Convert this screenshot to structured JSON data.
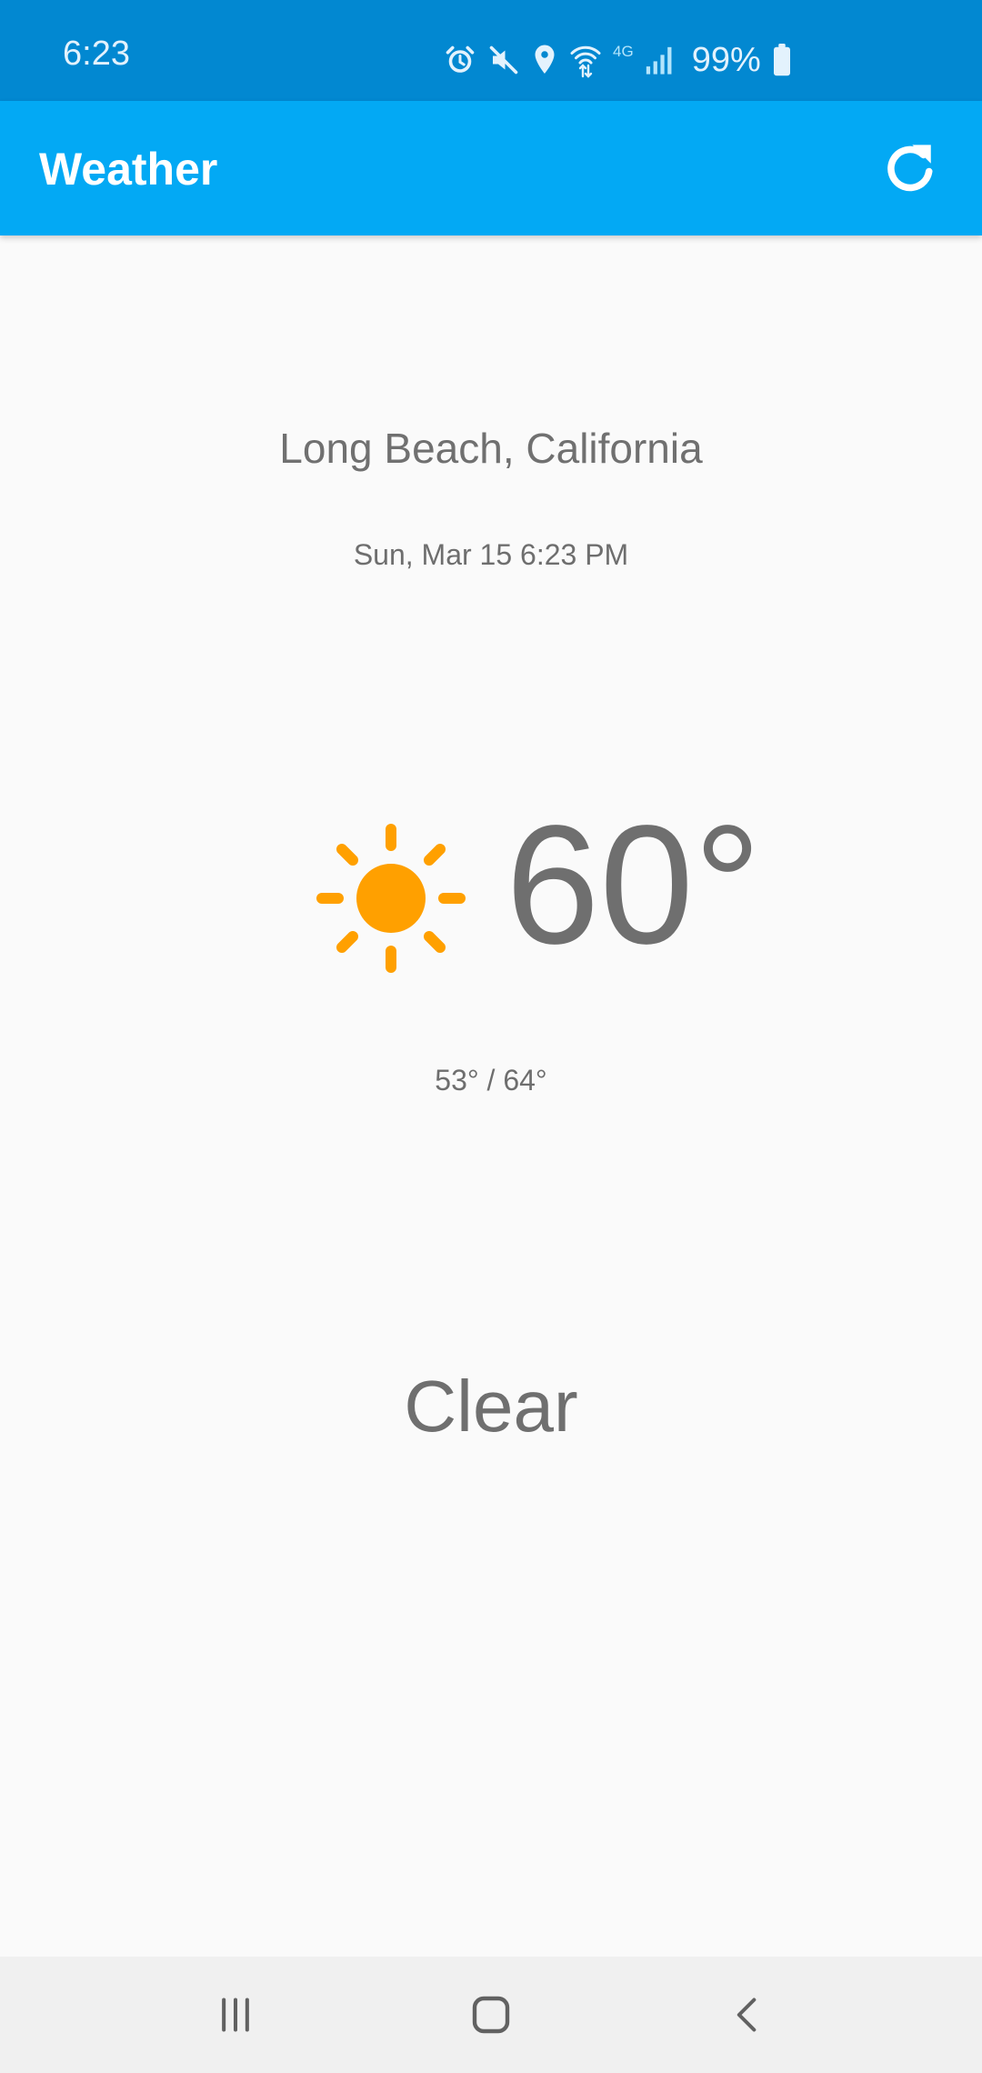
{
  "status_bar": {
    "time": "6:23",
    "network_label": "4G",
    "battery": "99%",
    "icons": [
      "alarm-icon",
      "mute-icon",
      "location-icon",
      "wifi-icon",
      "signal-icon",
      "battery-icon"
    ]
  },
  "app_bar": {
    "title": "Weather",
    "refresh_icon": "refresh-icon"
  },
  "weather": {
    "location": "Long Beach, California",
    "datetime": "Sun, Mar 15 6:23 PM",
    "temperature": "60°",
    "low_high": "53° / 64°",
    "condition": "Clear",
    "condition_icon": "sun-icon"
  },
  "nav_bar": {
    "icons": [
      "recent-apps-icon",
      "home-icon",
      "back-icon"
    ]
  },
  "colors": {
    "status_bar": "#0288d1",
    "app_bar": "#03a9f4",
    "sun": "#ffa000",
    "text": "#6f6f6f",
    "background": "#fafafa"
  }
}
